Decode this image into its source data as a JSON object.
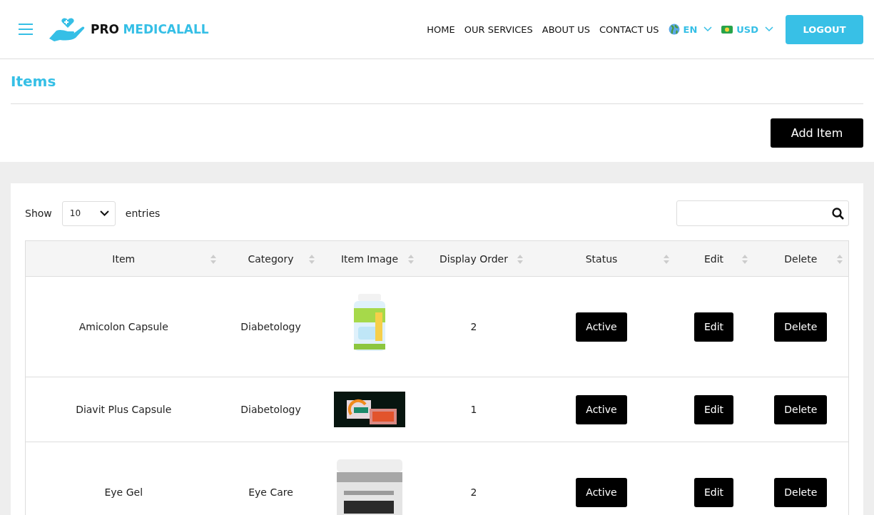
{
  "header": {
    "brand": {
      "first": "PRO",
      "second": "MEDICALALL"
    },
    "nav": [
      "HOME",
      "OUR SERVICES",
      "ABOUT US",
      "CONTACT US"
    ],
    "language": "EN",
    "currency": "USD",
    "logout": "LOGOUT"
  },
  "page_title": "Items",
  "add_button": "Add Item",
  "table_controls": {
    "show_label": "Show",
    "page_size": "10",
    "entries_label": "entries"
  },
  "table": {
    "columns": [
      "Item",
      "Category",
      "Item Image",
      "Display Order",
      "Status",
      "Edit",
      "Delete"
    ],
    "rows": [
      {
        "item": "Amicolon Capsule",
        "category": "Diabetology",
        "display_order": "2",
        "status": "Active",
        "edit": "Edit",
        "delete": "Delete"
      },
      {
        "item": "Diavit Plus Capsule",
        "category": "Diabetology",
        "display_order": "1",
        "status": "Active",
        "edit": "Edit",
        "delete": "Delete"
      },
      {
        "item": "Eye Gel",
        "category": "Eye Care",
        "display_order": "2",
        "status": "Active",
        "edit": "Edit",
        "delete": "Delete"
      }
    ]
  }
}
